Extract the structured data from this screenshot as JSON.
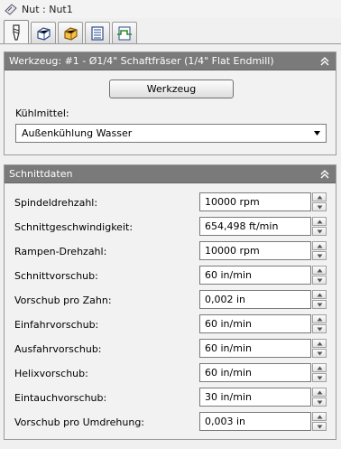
{
  "window": {
    "title": "Nut : Nut1"
  },
  "tabs": [
    {
      "icon": "tool-icon",
      "active": true
    },
    {
      "icon": "cube-icon",
      "active": false
    },
    {
      "icon": "box-icon",
      "active": false
    },
    {
      "icon": "list-icon",
      "active": false
    },
    {
      "icon": "linking-icon",
      "active": false
    }
  ],
  "tool_panel": {
    "title": "Werkzeug: #1 - Ø1/4\" Schaftfräser (1/4\" Flat Endmill)",
    "tool_button": "Werkzeug",
    "coolant_label": "Kühlmittel:",
    "coolant_value": "Außenkühlung Wasser"
  },
  "cutting_panel": {
    "title": "Schnittdaten",
    "rows": [
      {
        "label": "Spindeldrehzahl:",
        "value": "10000 rpm"
      },
      {
        "label": "Schnittgeschwindigkeit:",
        "value": "654,498 ft/min"
      },
      {
        "label": "Rampen-Drehzahl:",
        "value": "10000 rpm"
      },
      {
        "label": "Schnittvorschub:",
        "value": "60 in/min"
      },
      {
        "label": "Vorschub pro Zahn:",
        "value": "0,002 in"
      },
      {
        "label": "Einfahrvorschub:",
        "value": "60 in/min"
      },
      {
        "label": "Ausfahrvorschub:",
        "value": "60 in/min"
      },
      {
        "label": "Helixvorschub:",
        "value": "60 in/min"
      },
      {
        "label": "Eintauchvorschub:",
        "value": "30 in/min"
      },
      {
        "label": "Vorschub pro Umdrehung:",
        "value": "0,003 in"
      }
    ]
  }
}
